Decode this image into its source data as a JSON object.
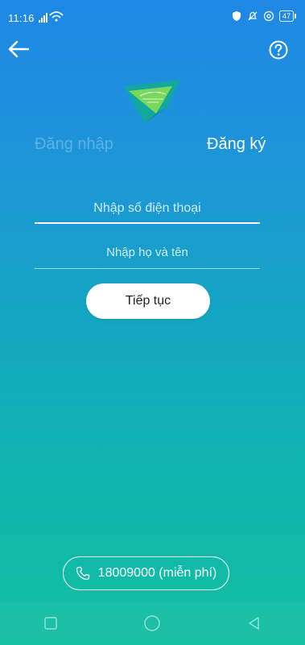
{
  "status_bar": {
    "time": "11:16",
    "battery": "47"
  },
  "tabs": {
    "login": "Đăng nhập",
    "register": "Đăng ký"
  },
  "form": {
    "phone_placeholder": "Nhập số điện thoại",
    "phone_value": "",
    "name_placeholder": "Nhập họ và tên",
    "name_value": "",
    "continue_label": "Tiếp tục"
  },
  "hotline": {
    "label": "18009000 (miễn phí)"
  },
  "colors": {
    "gradient_top": "#1E88E5",
    "gradient_bottom": "#12BFA1",
    "logo_green": "#7ED957",
    "logo_teal": "#13A89E"
  },
  "icons": {
    "back": "arrow-left-icon",
    "help": "question-circle-icon",
    "phone": "phone-icon",
    "nav_recent": "square-icon",
    "nav_home": "circle-icon",
    "nav_back": "triangle-left-icon"
  }
}
